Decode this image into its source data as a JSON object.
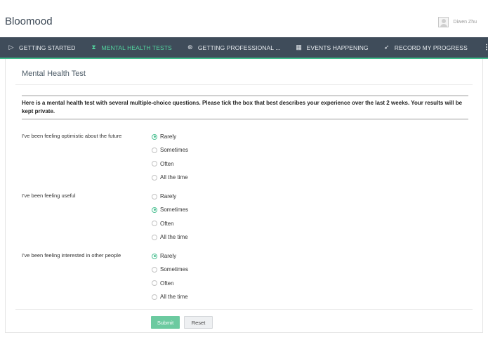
{
  "app": {
    "brand": "Bloomood",
    "user_name": "Diwen Zhu"
  },
  "nav": {
    "items": [
      {
        "label": "GETTING STARTED",
        "icon": "play-icon",
        "glyph": "▷",
        "active": false
      },
      {
        "label": "MENTAL HEALTH TESTS",
        "icon": "hourglass-icon",
        "glyph": "⧗",
        "active": true
      },
      {
        "label": "GETTING PROFESSIONAL ...",
        "icon": "compass-icon",
        "glyph": "⊛",
        "active": false
      },
      {
        "label": "EVENTS HAPPENING",
        "icon": "calendar-icon",
        "glyph": "▦",
        "active": false
      },
      {
        "label": "RECORD MY PROGRESS",
        "icon": "rocket-icon",
        "glyph": "➶",
        "active": false
      }
    ],
    "more_glyph": "⋮"
  },
  "page": {
    "title": "Mental Health Test",
    "intro": "Here is a mental health test with several multiple-choice questions. Please tick the box that best describes your experience over the last 2 weeks. Your results will be kept private."
  },
  "questions": [
    {
      "text": "I've been feeling optimistic about the future",
      "options": [
        "Rarely",
        "Sometimes",
        "Often",
        "All the time"
      ],
      "selected": "Rarely"
    },
    {
      "text": "I've been feeling useful",
      "options": [
        "Rarely",
        "Sometimes",
        "Often",
        "All the time"
      ],
      "selected": "Sometimes"
    },
    {
      "text": "I've been feeling interested in other people",
      "options": [
        "Rarely",
        "Sometimes",
        "Often",
        "All the time"
      ],
      "selected": "Rarely"
    }
  ],
  "buttons": {
    "submit": "Submit",
    "reset": "Reset"
  },
  "colors": {
    "nav_bg": "#3f4c5a",
    "accent": "#53d6a0",
    "submit_bg": "#6ccaa0"
  }
}
